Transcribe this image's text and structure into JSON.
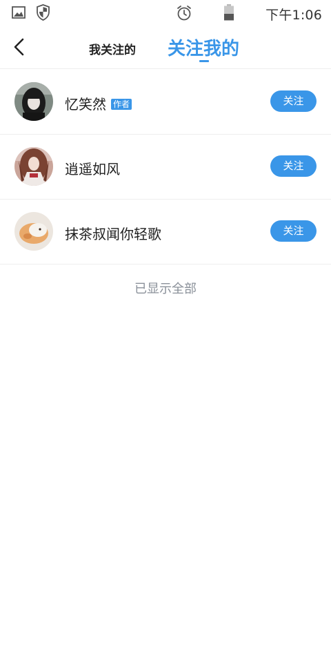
{
  "status_bar": {
    "time": "下午1:06",
    "icons": [
      "gallery-icon",
      "shield-icon",
      "alarm-icon",
      "battery-icon"
    ]
  },
  "header": {
    "back_icon": "chevron-left-icon",
    "tabs": [
      {
        "label": "我关注的",
        "active": false
      },
      {
        "label": "关注我的",
        "active": true
      }
    ]
  },
  "followers": [
    {
      "name": "忆笑然",
      "tag": "作者",
      "button": "关注"
    },
    {
      "name": "逍遥如风",
      "tag": "",
      "button": "关注"
    },
    {
      "name": "抹茶叔闻你轻歌",
      "tag": "",
      "button": "关注"
    }
  ],
  "end_text": "已显示全部",
  "colors": {
    "accent": "#3a96e8",
    "divider": "#eeeeee",
    "muted_text": "#8a9099"
  }
}
